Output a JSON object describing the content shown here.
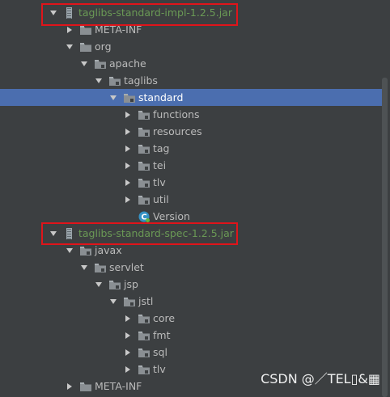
{
  "tree": {
    "rows": [
      {
        "label": "taglibs-standard-impl-1.2.5.jar",
        "type": "jar",
        "depth": 0,
        "expanded": true,
        "indentPx": 60
      },
      {
        "label": "META-INF",
        "type": "folder",
        "depth": 1,
        "expanded": false,
        "indentPx": 80
      },
      {
        "label": "org",
        "type": "folder",
        "depth": 1,
        "expanded": true,
        "indentPx": 80
      },
      {
        "label": "apache",
        "type": "package",
        "depth": 2,
        "expanded": true,
        "indentPx": 98
      },
      {
        "label": "taglibs",
        "type": "package",
        "depth": 3,
        "expanded": true,
        "indentPx": 116
      },
      {
        "label": "standard",
        "type": "package",
        "depth": 4,
        "expanded": true,
        "selected": true,
        "indentPx": 134
      },
      {
        "label": "functions",
        "type": "package",
        "depth": 5,
        "expanded": false,
        "indentPx": 152
      },
      {
        "label": "resources",
        "type": "package",
        "depth": 5,
        "expanded": false,
        "indentPx": 152
      },
      {
        "label": "tag",
        "type": "package",
        "depth": 5,
        "expanded": false,
        "indentPx": 152
      },
      {
        "label": "tei",
        "type": "package",
        "depth": 5,
        "expanded": false,
        "indentPx": 152
      },
      {
        "label": "tlv",
        "type": "package",
        "depth": 5,
        "expanded": false,
        "indentPx": 152
      },
      {
        "label": "util",
        "type": "package",
        "depth": 5,
        "expanded": false,
        "indentPx": 152
      },
      {
        "label": "Version",
        "type": "class",
        "depth": 5,
        "leaf": true,
        "indentPx": 152
      },
      {
        "label": "taglibs-standard-spec-1.2.5.jar",
        "type": "jar",
        "depth": 0,
        "expanded": true,
        "indentPx": 60
      },
      {
        "label": "javax",
        "type": "package",
        "depth": 1,
        "expanded": true,
        "indentPx": 80
      },
      {
        "label": "servlet",
        "type": "package",
        "depth": 2,
        "expanded": true,
        "indentPx": 98
      },
      {
        "label": "jsp",
        "type": "package",
        "depth": 3,
        "expanded": true,
        "indentPx": 116
      },
      {
        "label": "jstl",
        "type": "package",
        "depth": 4,
        "expanded": true,
        "indentPx": 134
      },
      {
        "label": "core",
        "type": "package",
        "depth": 5,
        "expanded": false,
        "indentPx": 152
      },
      {
        "label": "fmt",
        "type": "package",
        "depth": 5,
        "expanded": false,
        "indentPx": 152
      },
      {
        "label": "sql",
        "type": "package",
        "depth": 5,
        "expanded": false,
        "indentPx": 152
      },
      {
        "label": "tlv",
        "type": "package",
        "depth": 5,
        "expanded": false,
        "indentPx": 152
      },
      {
        "label": "META-INF",
        "type": "folder",
        "depth": 1,
        "expanded": false,
        "indentPx": 80
      }
    ]
  },
  "watermark": {
    "text": "CSDN @／TEL▯&▦"
  },
  "colors": {
    "background": "#3c3f41",
    "selection": "#4b6eaf",
    "jar_text": "#6a9955",
    "text": "#bbbbbb",
    "highlight_border": "#e0141a",
    "folder_icon": "#8a8f93",
    "package_dot": "#6d8fb4"
  }
}
